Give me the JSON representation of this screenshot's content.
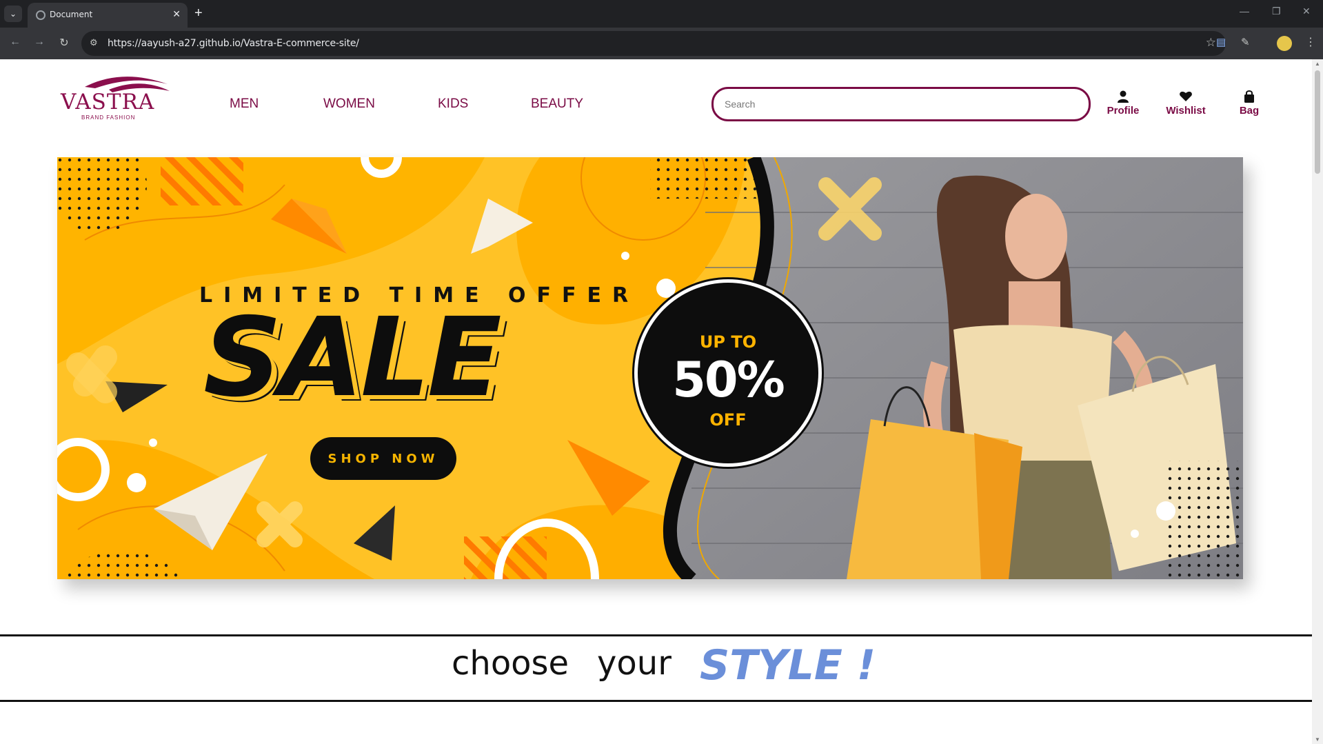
{
  "browser": {
    "tab_title": "Document",
    "url": "https://aayush-a27.github.io/Vastra-E-commerce-site/"
  },
  "site": {
    "logo_text": "VASTRA",
    "logo_sub": "BRAND FASHION",
    "nav": [
      "MEN",
      "WOMEN",
      "KIDS",
      "BEAUTY"
    ],
    "search_placeholder": "Search",
    "actions": {
      "profile": "Profile",
      "wishlist": "Wishlist",
      "bag": "Bag"
    },
    "brand_color": "#7a0b45"
  },
  "banner": {
    "headline": "LIMITED TIME OFFER",
    "sale": "SALE",
    "button": "SHOP NOW",
    "offer_top": "UP TO",
    "offer_pct": "50%",
    "offer_bottom": "OFF",
    "accent": "#ffc429"
  },
  "tagline": {
    "word1": "choose",
    "word2": "your",
    "word3": "STYLE !",
    "accent": "#6b8fd9"
  }
}
